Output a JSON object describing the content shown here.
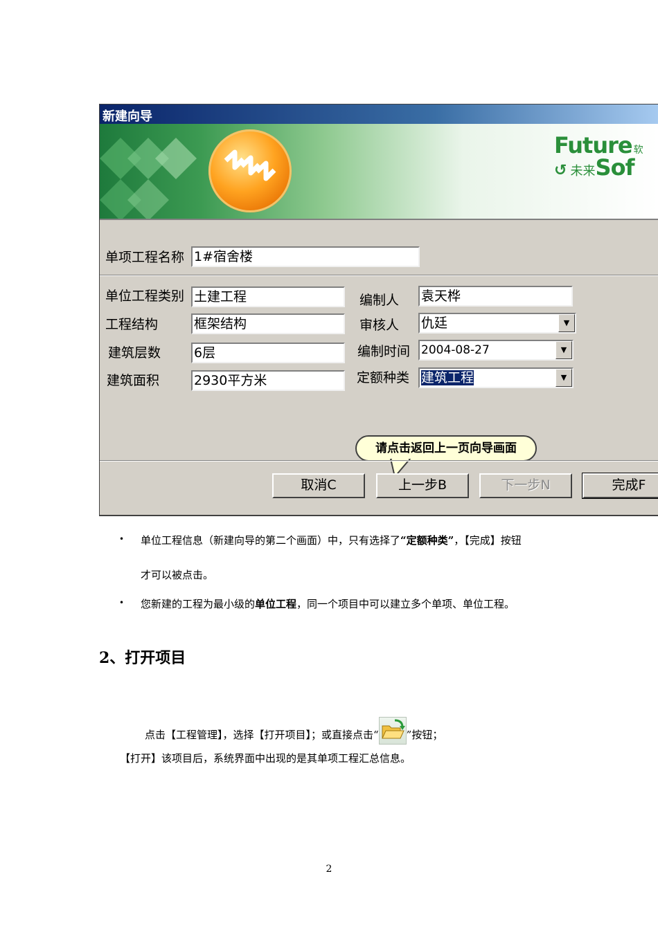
{
  "dialog": {
    "title": "新建向导",
    "brand": {
      "future": "Future",
      "future_cn": "软",
      "soft_cn": "未来",
      "soft": "Sof"
    },
    "fields": {
      "item_name_label": "单项工程名称",
      "item_name_value": "1#宿舍楼",
      "unit_type_label": "单位工程类别",
      "unit_type_value": "土建工程",
      "structure_label": "工程结构",
      "structure_value": "框架结构",
      "floors_label": "建筑层数",
      "floors_value": "6层",
      "area_label": "建筑面积",
      "area_value": "2930平方米",
      "author_label": "编制人",
      "author_value": "袁天桦",
      "reviewer_label": "审核人",
      "reviewer_value": "仇廷",
      "date_label": "编制时间",
      "date_value": "2004-08-27",
      "quota_label": "定额种类",
      "quota_value": "建筑工程"
    },
    "tooltip": "请点击返回上一页向导画面",
    "buttons": {
      "cancel": "取消C",
      "prev": "上一步B",
      "next": "下一步N",
      "finish": "完成F"
    }
  },
  "doc": {
    "bullet1_a": "单位工程信息（新建向导的第二个画面）中，只有选择了",
    "bullet1_b": "“定额种类”",
    "bullet1_c": "，【完成】按钮",
    "bullet1_cont": "才可以被点击。",
    "bullet2_a": "您新建的工程为最小级的",
    "bullet2_b": "单位工程",
    "bullet2_c": "，同一个项目中可以建立多个单项、单位工程。",
    "section_title": "2、打开项目",
    "para1_a": "点击【工程管理】，选择【打开项目】；或直接点击“",
    "para1_b": "”按钮；",
    "para2": "【打开】该项目后，系统界面中出现的是其单项工程汇总信息。",
    "page_number": "2"
  },
  "icons": {
    "open_project": "open-folder-icon",
    "logo": "futuresoft-logo-icon"
  }
}
